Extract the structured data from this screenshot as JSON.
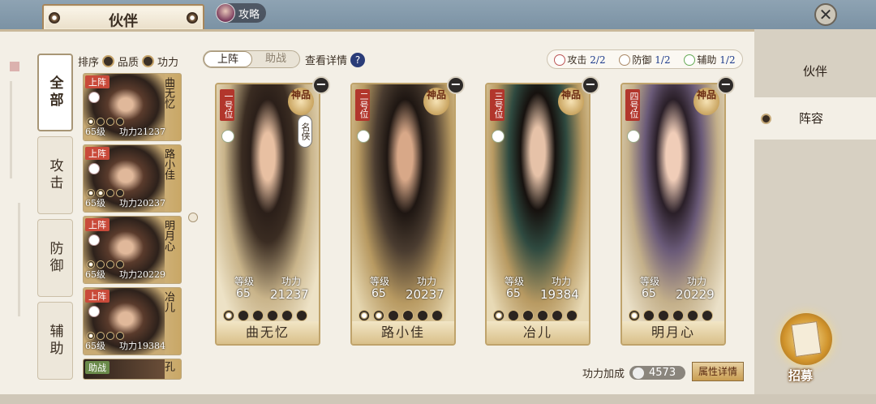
{
  "header": {
    "title": "伙伴",
    "guide_label": "攻略"
  },
  "categories": [
    "全部",
    "攻击",
    "防御",
    "辅助"
  ],
  "sort": {
    "label": "排序",
    "option1": "品质",
    "option2": "功力"
  },
  "roster": [
    {
      "badge": "上阵",
      "name": "曲无忆",
      "level_prefix": "65级",
      "power": "功力21237",
      "filled": 1
    },
    {
      "badge": "上阵",
      "name": "路小佳",
      "level_prefix": "65级",
      "power": "功力20237",
      "filled": 2
    },
    {
      "badge": "上阵",
      "name": "明月心",
      "level_prefix": "65级",
      "power": "功力20229",
      "filled": 1
    },
    {
      "badge": "上阵",
      "name": "冶儿",
      "level_prefix": "65级",
      "power": "功力19384",
      "filled": 1
    },
    {
      "badge": "助战",
      "name": "孔"
    }
  ],
  "lineup_tabs": {
    "active": "上阵",
    "inactive": "助战"
  },
  "detail_label": "查看详情",
  "role_counts": [
    {
      "label": "攻击",
      "value": "2/2"
    },
    {
      "label": "防御",
      "value": "1/2"
    },
    {
      "label": "辅助",
      "value": "1/2"
    }
  ],
  "heroes": [
    {
      "slot": "一号位",
      "grade": "神品",
      "tag": "名侠",
      "level_label": "等级",
      "level": "65",
      "power_label": "功力",
      "power": "21237",
      "name": "曲无忆",
      "filled": 1
    },
    {
      "slot": "二号位",
      "grade": "神品",
      "level_label": "等级",
      "level": "65",
      "power_label": "功力",
      "power": "20237",
      "name": "路小佳",
      "filled": 2
    },
    {
      "slot": "三号位",
      "grade": "神品",
      "level_label": "等级",
      "level": "65",
      "power_label": "功力",
      "power": "19384",
      "name": "冶儿",
      "filled": 1
    },
    {
      "slot": "四号位",
      "grade": "神品",
      "level_label": "等级",
      "level": "65",
      "power_label": "功力",
      "power": "20229",
      "name": "明月心",
      "filled": 1
    }
  ],
  "bonus": {
    "label": "功力加成",
    "value": "4573",
    "button": "属性详情"
  },
  "right_tabs": [
    "伙伴",
    "阵容"
  ],
  "recruit_label": "招募"
}
